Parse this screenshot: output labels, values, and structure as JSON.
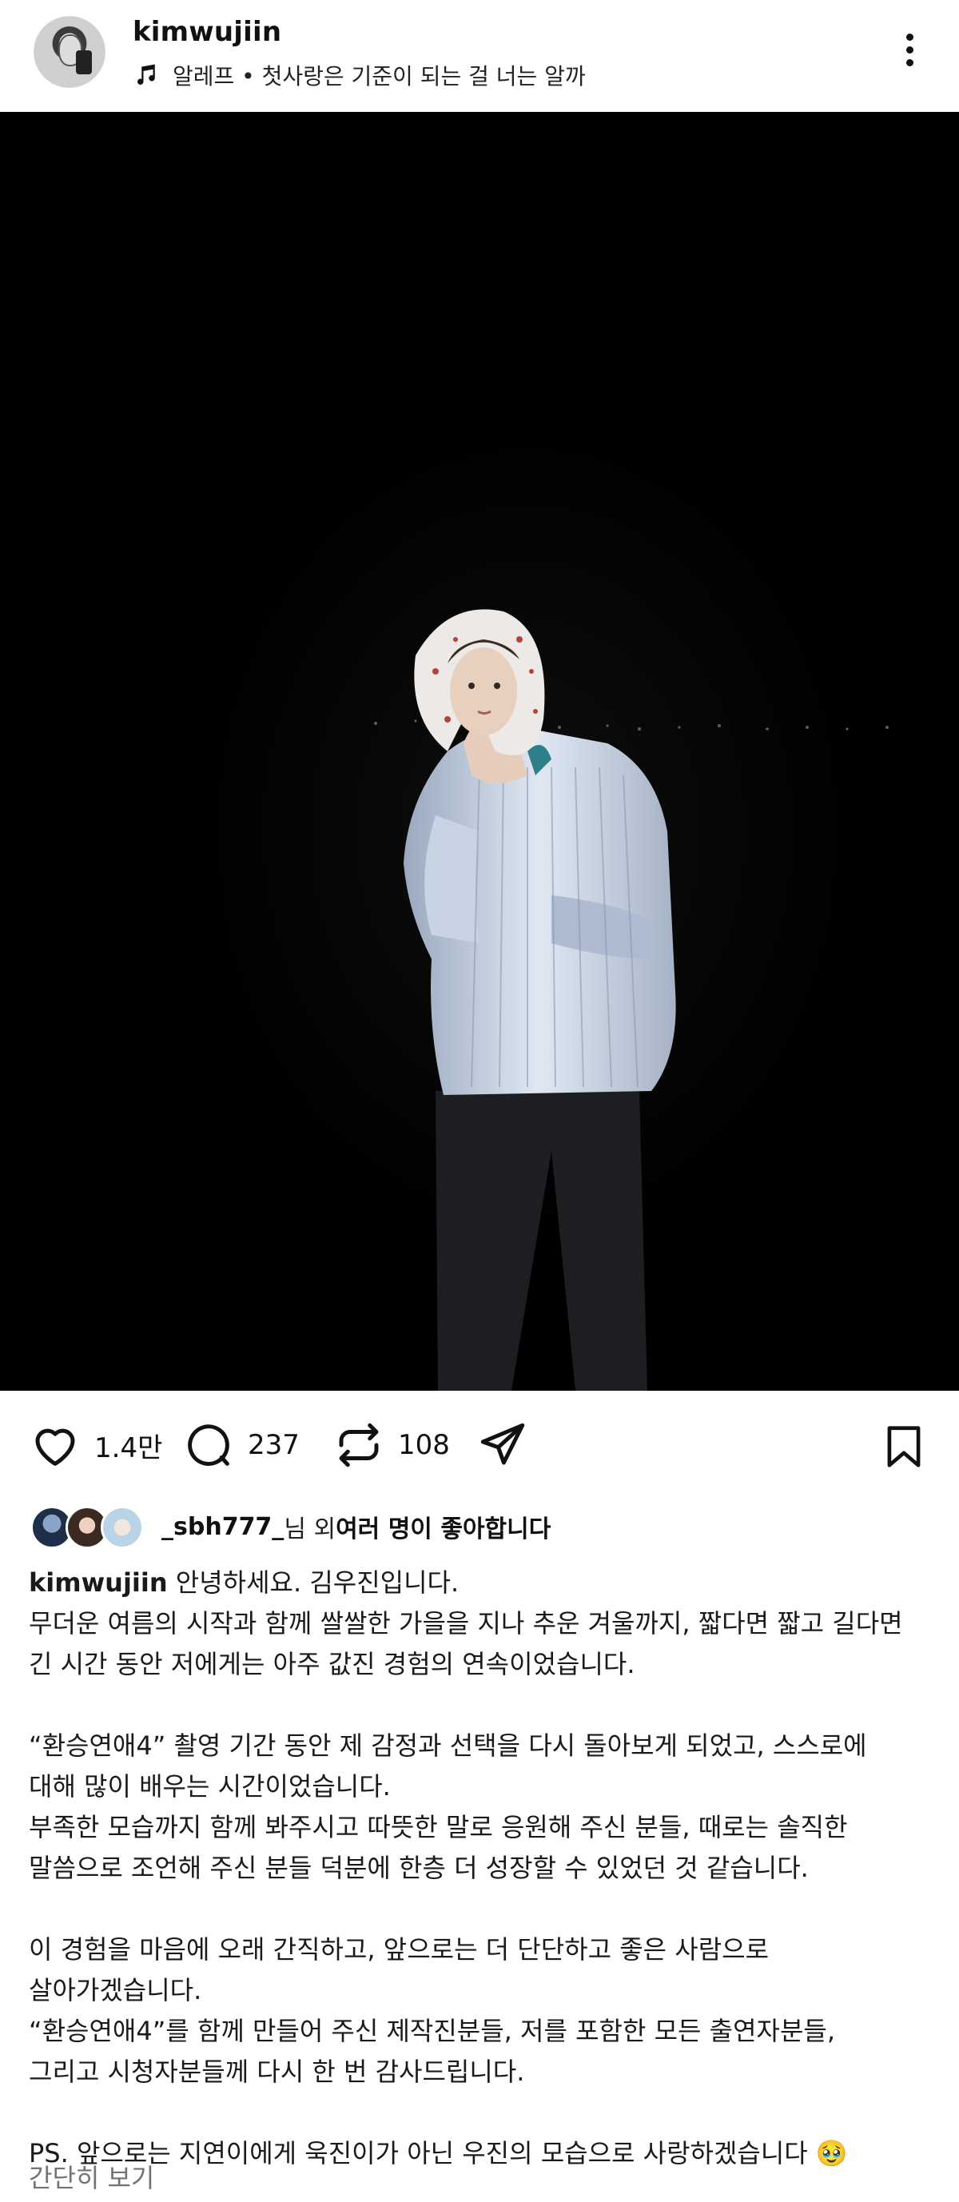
{
  "header": {
    "username": "kimwujiin",
    "music": "알레프 • 첫사랑은 기준이 되는 걸 너는 알까"
  },
  "actions": {
    "likes_count": "1.4만",
    "comments_count": "237",
    "reposts_count": "108"
  },
  "liked_by": {
    "user": "_sbh777_",
    "middle": "님 외 ",
    "rest": "여러 명이 좋아합니다"
  },
  "caption": {
    "username": "kimwujiin",
    "first_line": "안녕하세요. 김우진입니다.",
    "lines": [
      "무더운 여름의 시작과 함께 쌀쌀한 가을을 지나 추운 겨울까지, 짧다면 짧고 길다면",
      "긴 시간 동안 저에게는 아주 값진 경험의 연속이었습니다.",
      "",
      "“환승연애4” 촬영 기간 동안 제 감정과 선택을 다시 돌아보게 되었고, 스스로에",
      "대해 많이 배우는 시간이었습니다.",
      "부족한 모습까지 함께 봐주시고 따뜻한 말로 응원해 주신 분들, 때로는 솔직한",
      "말씀으로 조언해 주신 분들 덕분에 한층 더 성장할 수 있었던 것 같습니다.",
      "",
      "이 경험을 마음에 오래 간직하고, 앞으로는 더 단단하고 좋은 사람으로",
      "살아가겠습니다.",
      "“환승연애4”를 함께 만들어 주신 제작진분들, 저를 포함한 모든 출연자분들,",
      "그리고 시청자분들께 다시 한 번 감사드립니다.",
      "",
      "PS. 앞으로는 지연이에게 욱진이가 아닌 우진의 모습으로 사랑하겠습니다 🥹"
    ],
    "collapse_label": "간단히 보기"
  },
  "colors": {
    "text": "#111111",
    "muted": "#737373",
    "photo_bg": "#000000"
  },
  "icons": [
    "music-note-icon",
    "more-options-icon",
    "mute-icon",
    "heart-icon",
    "comment-icon",
    "repost-icon",
    "share-icon",
    "bookmark-icon"
  ]
}
